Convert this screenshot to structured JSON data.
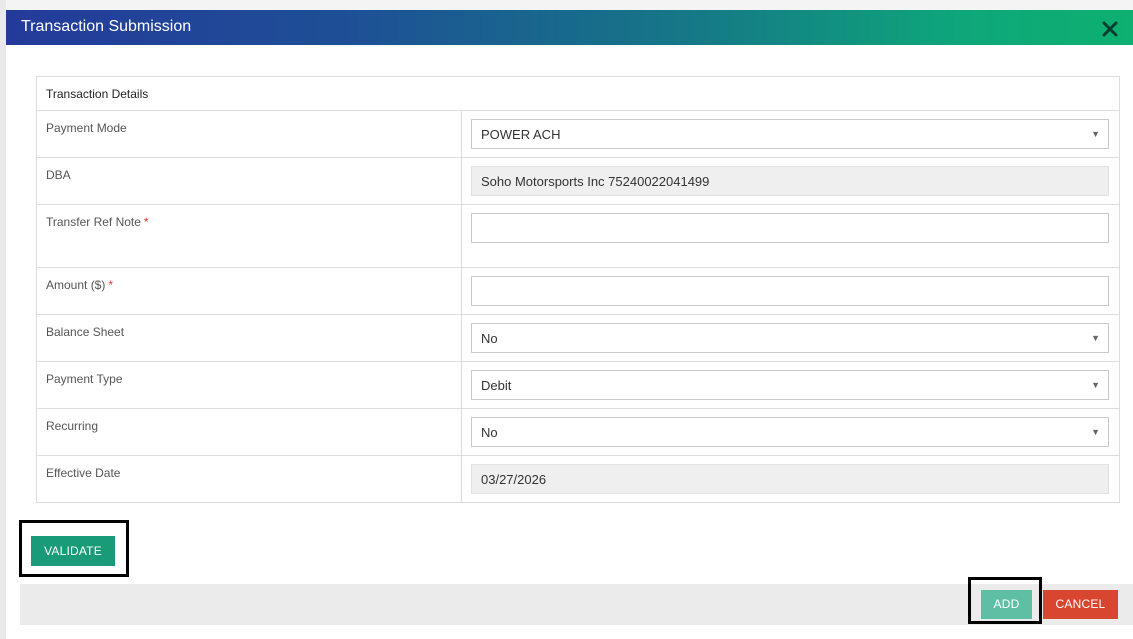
{
  "modal": {
    "title": "Transaction Submission",
    "close_icon": "close-x-icon"
  },
  "form": {
    "section_title": "Transaction Details",
    "payment_mode": {
      "label": "Payment Mode",
      "value": "POWER ACH"
    },
    "dba": {
      "label": "DBA",
      "value": "Soho Motorsports Inc 75240022041499"
    },
    "transfer_ref_note": {
      "label": "Transfer Ref Note",
      "required_mark": "*",
      "value": ""
    },
    "amount": {
      "label": "Amount ($)",
      "required_mark": "*",
      "value": ""
    },
    "balance_sheet": {
      "label": "Balance Sheet",
      "value": "No"
    },
    "payment_type": {
      "label": "Payment Type",
      "value": "Debit"
    },
    "recurring": {
      "label": "Recurring",
      "value": "No"
    },
    "effective_date": {
      "label": "Effective Date",
      "value": "03/27/2026"
    }
  },
  "actions": {
    "validate_label": "VALIDATE",
    "add_label": "ADD",
    "cancel_label": "CANCEL"
  },
  "colors": {
    "header_gradient_start": "#243a9a",
    "header_gradient_end": "#0db070",
    "validate": "#1a9b78",
    "add": "#5fbfa5",
    "cancel": "#d9462f",
    "required": "#e0342c"
  }
}
